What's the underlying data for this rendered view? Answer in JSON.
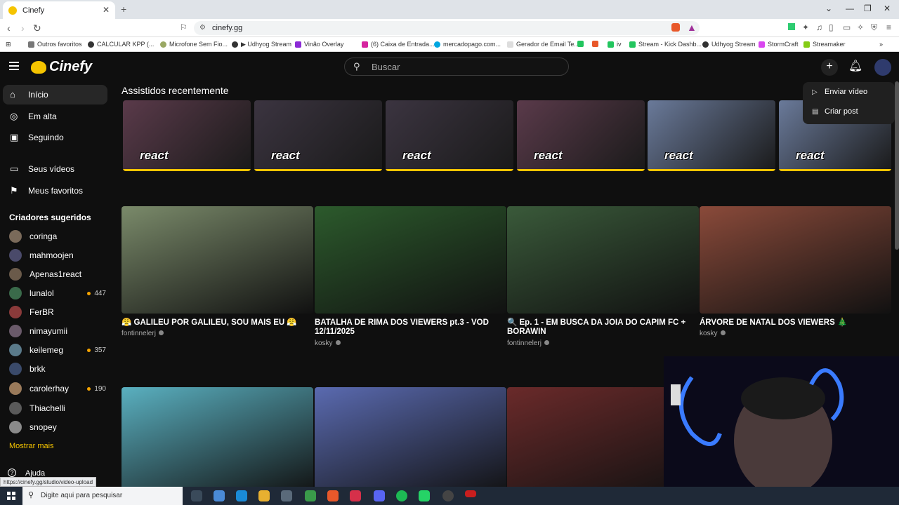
{
  "browser": {
    "tab_title": "Cinefy",
    "url": "cinefy.gg",
    "bookmarks": [
      "Outros favoritos",
      "CALCULAR KPP (...",
      "Microfone Sem Fio...",
      "▶ Udhyog Stream",
      "Vinão Overlay",
      "(6) Caixa de Entrada...",
      "mercadopago.com...",
      "Gerador de Email Te...",
      "iv",
      "Stream - Kick Dashb...",
      "Udhyog Stream",
      "StormCraft",
      "Streamaker"
    ],
    "status_url": "https://cinefy.gg/studio/video-upload"
  },
  "header": {
    "logo": "Cinefy",
    "search_placeholder": "Buscar"
  },
  "sidebar": {
    "nav": [
      {
        "label": "Início",
        "icon": "home-icon"
      },
      {
        "label": "Em alta",
        "icon": "flame-icon"
      },
      {
        "label": "Seguindo",
        "icon": "subscriptions-icon"
      },
      {
        "label": "Seus vídeos",
        "icon": "your-videos-icon"
      },
      {
        "label": "Meus favoritos",
        "icon": "bookmark-icon"
      }
    ],
    "creators_title": "Criadores sugeridos",
    "creators": [
      {
        "name": "coringa",
        "count": ""
      },
      {
        "name": "mahmoojen",
        "count": ""
      },
      {
        "name": "Apenas1react",
        "count": ""
      },
      {
        "name": "lunalol",
        "count": "447"
      },
      {
        "name": "FerBR",
        "count": ""
      },
      {
        "name": "nimayumii",
        "count": ""
      },
      {
        "name": "keilemeg",
        "count": "357"
      },
      {
        "name": "brkk",
        "count": ""
      },
      {
        "name": "carolerhay",
        "count": "190"
      },
      {
        "name": "Thiachelli",
        "count": ""
      },
      {
        "name": "snopey",
        "count": ""
      }
    ],
    "more_label": "Mostrar mais",
    "help_label": "Ajuda"
  },
  "dropdown": {
    "items": [
      {
        "label": "Enviar vídeo",
        "icon": "upload-video-icon"
      },
      {
        "label": "Criar post",
        "icon": "post-icon"
      }
    ]
  },
  "main": {
    "recent_title": "Assistidos recentemente",
    "recent": [
      {
        "label": "react",
        "color": "#5a3a4a"
      },
      {
        "label": "react",
        "color": "#3b3440"
      },
      {
        "label": "react",
        "color": "#3b3440"
      },
      {
        "label": "react",
        "color": "#5a3a4a"
      },
      {
        "label": "react",
        "color": "#6a7a9a"
      },
      {
        "label": "react",
        "color": "#6a7a9a"
      }
    ],
    "videos": [
      {
        "title": "😤 GALILEU POR GALILEU, SOU MAIS EU 😤",
        "author": "fontinnelerj",
        "color": "#7a8a6a"
      },
      {
        "title": "BATALHA DE RIMA DOS VIEWERS pt.3 - VOD 12/11/2025",
        "author": "kosky",
        "color": "#2c5a2c"
      },
      {
        "title": "🔍 Ep. 1 - EM BUSCA DA JOIA DO CAPIM FC + BORAWIN",
        "author": "fontinnelerj",
        "color": "#3a5a3a"
      },
      {
        "title": "ÁRVORE DE NATAL DOS VIEWERS 🎄",
        "author": "kosky",
        "color": "#8a4a3a"
      },
      {
        "title": "",
        "author": "",
        "color": "#5ab0c0"
      },
      {
        "title": "",
        "author": "",
        "color": "#5a6ab0"
      },
      {
        "title": "",
        "author": "",
        "color": "#6a2a2a"
      }
    ]
  },
  "taskbar": {
    "search_placeholder": "Digite aqui para pesquisar"
  }
}
